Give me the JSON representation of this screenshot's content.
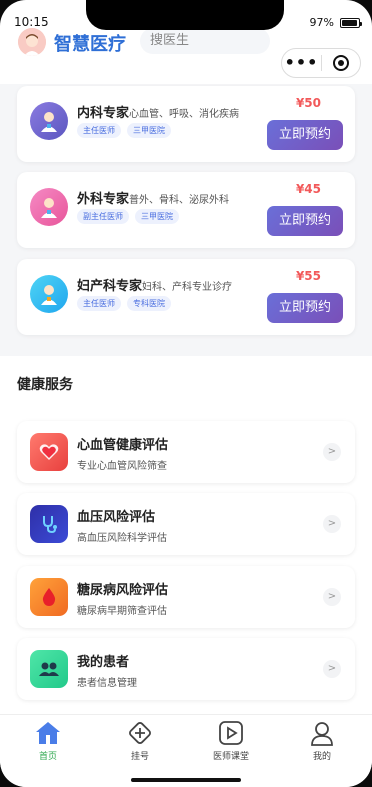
{
  "status": {
    "time": "10:15",
    "battery": "97%"
  },
  "header": {
    "brand": "智慧医疗",
    "search_placeholder": "搜医生"
  },
  "doctors": [
    {
      "name": "内科专家",
      "desc": "心血管、呼吸、消化疾病",
      "tags": [
        "主任医师",
        "三甲医院"
      ],
      "price": "¥50",
      "button": "立即预约",
      "color": "#6b67cc"
    },
    {
      "name": "外科专家",
      "desc": "普外、骨科、泌尿外科",
      "tags": [
        "副主任医师",
        "三甲医院"
      ],
      "price": "¥45",
      "button": "立即预约",
      "color": "#f06aa8"
    },
    {
      "name": "妇产科专家",
      "desc": "妇科、产科专业诊疗",
      "tags": [
        "主任医师",
        "专科医院"
      ],
      "price": "¥55",
      "button": "立即预约",
      "color": "#34c0f0"
    }
  ],
  "health": {
    "title": "健康服务",
    "services": [
      {
        "title": "心血管健康评估",
        "sub": "专业心血管风险筛查",
        "icon": "heart-icon",
        "color": "#f0504f"
      },
      {
        "title": "血压风险评估",
        "sub": "高血压风险科学评估",
        "icon": "stethoscope-icon",
        "color": "#3b3fc8"
      },
      {
        "title": "糖尿病风险评估",
        "sub": "糖尿病早期筛查评估",
        "icon": "droplet-icon",
        "color": "#f5802a"
      },
      {
        "title": "我的患者",
        "sub": "患者信息管理",
        "icon": "people-icon",
        "color": "#37d69a"
      }
    ]
  },
  "tabbar": [
    "首页",
    "挂号",
    "医师课堂",
    "我的"
  ],
  "colors": {
    "accent": "#2fa84f",
    "brand": "#2f6fd6",
    "button": "#6a6fd8",
    "price": "#f2595a"
  }
}
